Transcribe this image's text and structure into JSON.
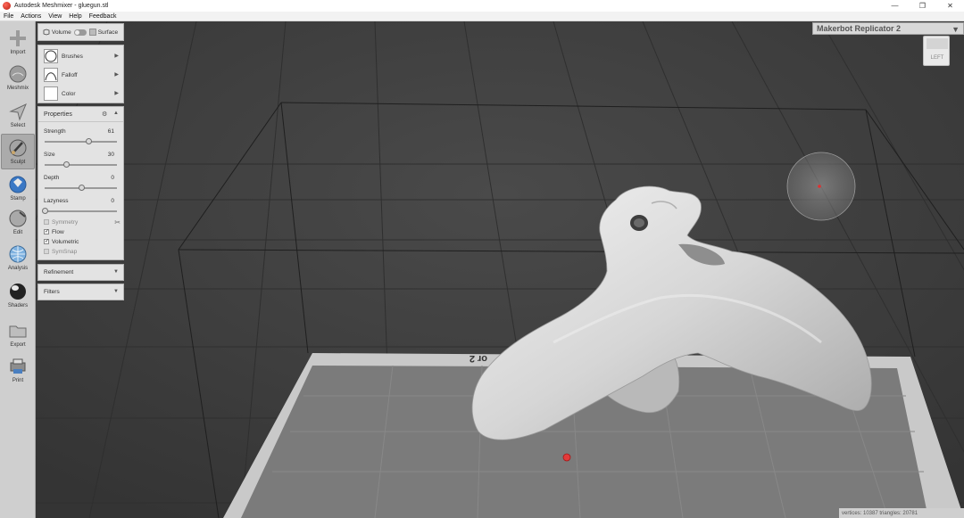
{
  "window": {
    "title": "Autodesk Meshmixer - gluegun.stl",
    "minimize": "—",
    "maximize": "❐",
    "close": "✕"
  },
  "menu": [
    "File",
    "Actions",
    "View",
    "Help",
    "Feedback"
  ],
  "toolbar": [
    "Import",
    "Meshmix",
    "Select",
    "Sculpt",
    "Stamp",
    "Edit",
    "Analysis",
    "Shaders",
    "Export",
    "Print"
  ],
  "sculpt_panel": {
    "mode_volume": "Volume",
    "mode_surface": "Surface",
    "brushes": "Brushes",
    "falloff": "Falloff",
    "color": "Color",
    "properties_title": "Properties",
    "sliders": [
      {
        "label": "Strength",
        "value": "61",
        "fraction": 0.61
      },
      {
        "label": "Size",
        "value": "30",
        "fraction": 0.3
      },
      {
        "label": "Depth",
        "value": "0",
        "fraction": 0.5
      },
      {
        "label": "Lazyness",
        "value": "0",
        "fraction": 0.0
      }
    ],
    "checkboxes": [
      {
        "label": "Symmetry",
        "checked": false,
        "enabled": false
      },
      {
        "label": "Flow",
        "checked": true,
        "enabled": true
      },
      {
        "label": "Volumetric",
        "checked": true,
        "enabled": true
      },
      {
        "label": "SymSnap",
        "checked": false,
        "enabled": false
      }
    ],
    "refinement": "Refinement",
    "filters": "Filters"
  },
  "printer": {
    "name": "Makerbot Replicator 2"
  },
  "viewcube": {
    "face": "LEFT"
  },
  "build_plate_label": "or 2",
  "status": "vertices: 10387 triangles: 20781"
}
